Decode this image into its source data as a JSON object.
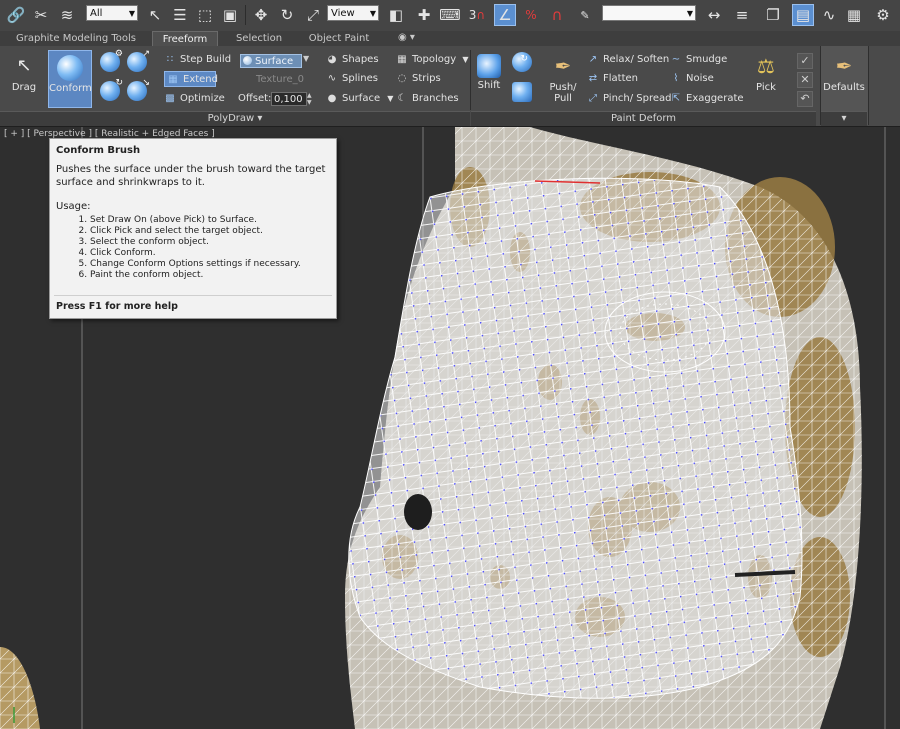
{
  "toolbar": {
    "selection_filter": "All",
    "reference_coord": "View",
    "snaps_numeric": "3",
    "named_selection": "",
    "icons": [
      "link-icon",
      "unlink-icon",
      "bind-space-warp-icon",
      "select-object-icon",
      "select-by-name-icon",
      "rect-region-icon",
      "window-crossing-icon",
      "move-icon",
      "rotate-icon",
      "scale-icon",
      "pivot-icon",
      "manipulate-icon",
      "keyboard-shortcut-icon",
      "snap-icon",
      "angle-snap-icon",
      "percent-snap-icon",
      "spinner-snap-icon",
      "edit-named-selection-icon",
      "mirror-icon",
      "align-icon",
      "layer-manager-icon",
      "ribbon-toggle-icon",
      "curve-editor-icon",
      "render-setup-icon",
      "render-frame-icon"
    ]
  },
  "ribbon_tabs": [
    {
      "label": "Graphite Modeling Tools"
    },
    {
      "label": "Freeform"
    },
    {
      "label": "Selection"
    },
    {
      "label": "Object Paint"
    }
  ],
  "ribbon_tabs_more": "◉ ▾",
  "ribbon": {
    "drag_label": "Drag",
    "conform_label": "Conform",
    "step_build_label": "Step Build",
    "extend_label": "Extend",
    "optimize_label": "Optimize",
    "draw_on_value": "Surface",
    "texture_label": "Texture_0",
    "offset_label": "Offset:",
    "offset_value": "0,100",
    "shapes_label": "Shapes",
    "splines_label": "Splines",
    "surface_label": "Surface",
    "topology_label": "Topology",
    "strips_label": "Strips",
    "branches_label": "Branches",
    "polydraw_label": "PolyDraw ▾",
    "shift_label": "Shift",
    "push_pull_label": "Push/\nPull",
    "relax_label": "Relax/ Soften",
    "flatten_label": "Flatten",
    "pinch_label": "Pinch/ Spread",
    "smudge_label": "Smudge",
    "noise_label": "Noise",
    "exaggerate_label": "Exaggerate",
    "pick_label": "Pick",
    "paint_deform_label": "Paint Deform",
    "defaults_label": "Defaults",
    "defaults_more": "▾"
  },
  "viewport": {
    "label": "[ + ] [ Perspective ] [ Realistic + Edged Faces ]"
  },
  "tooltip": {
    "title": "Conform Brush",
    "description": "Pushes the surface under the brush toward the target surface and shrinkwraps to it.",
    "usage_label": "Usage:",
    "steps": [
      "Set Draw On (above Pick) to Surface.",
      "Click Pick and select the target object.",
      "Select the conform object.",
      "Click Conform.",
      "Change Conform Options settings if necessary.",
      "Paint the conform object."
    ],
    "help": "Press F1 for more help"
  },
  "colors": {
    "accent": "#5c87c2",
    "vertex": "#4b4bff",
    "mesh_skin": "#b89a62"
  }
}
